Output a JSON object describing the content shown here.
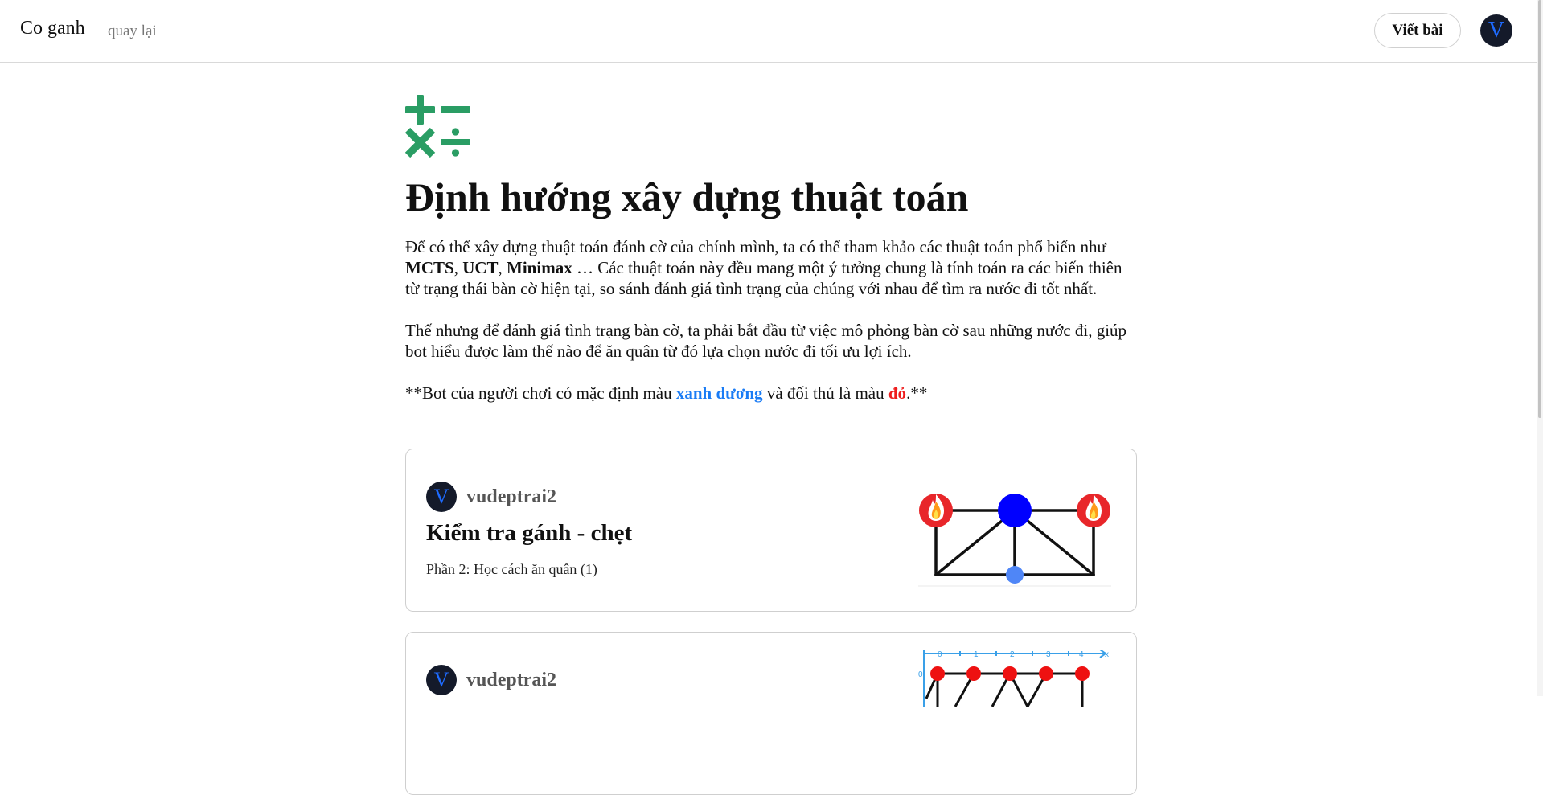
{
  "header": {
    "brand": "Co ganh",
    "back_link": "quay lại",
    "write_button": "Viết bài",
    "avatar_letter": "V"
  },
  "article": {
    "icon": "math-operators-icon",
    "title": "Định hướng xây dựng thuật toán",
    "p1": {
      "t1": "Để có thể xây dựng thuật toán đánh cờ của chính mình, ta có thể tham khảo các thuật toán phổ biến như ",
      "b1": "MCTS",
      "s1": ", ",
      "b2": "UCT",
      "s2": ", ",
      "b3": "Minimax",
      "t2": " … Các thuật toán này đều mang một ý tưởng chung là tính toán ra các biến thiên từ trạng thái bàn cờ hiện tại, so sánh đánh giá tình trạng của chúng với nhau để tìm ra nước đi tốt nhất."
    },
    "p2": "Thế nhưng để đánh giá tình trạng bàn cờ, ta phải bắt đầu từ việc mô phỏng bàn cờ sau những nước đi, giúp bot hiểu được làm thế nào để ăn quân từ đó lựa chọn nước đi tối ưu lợi ích.",
    "p3": {
      "t1": "**Bot của người chơi có mặc định màu ",
      "blue": "xanh dương",
      "t2": " và đối thủ là màu ",
      "red": "đỏ",
      "t3": ".**"
    }
  },
  "cards": [
    {
      "author": "vudeptrai2",
      "avatar_letter": "V",
      "title": "Kiểm tra gánh - chẹt",
      "subtitle": "Phần 2: Học cách ăn quân (1)",
      "thumbnail": "ganh-chet-diagram"
    },
    {
      "author": "vudeptrai2",
      "avatar_letter": "V",
      "title": "",
      "subtitle": "",
      "thumbnail": "board-coordinate-diagram",
      "axis_labels": [
        "0",
        "1",
        "2",
        "3",
        "4",
        "x"
      ],
      "y_label": "0"
    }
  ],
  "colors": {
    "icon_green": "#2a9d64",
    "player_blue": "#1a7cf5",
    "opponent_red": "#ee1c1c",
    "avatar_bg": "#141a2a"
  }
}
